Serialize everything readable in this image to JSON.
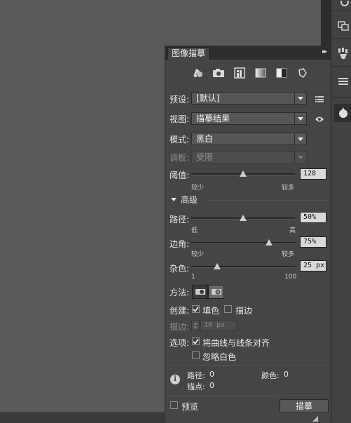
{
  "panel": {
    "title": "图像描摹",
    "menu_glyph": "▸▸"
  },
  "presets": [
    {
      "name": "auto-color-icon"
    },
    {
      "name": "high-color-icon"
    },
    {
      "name": "low-color-icon"
    },
    {
      "name": "grayscale-icon"
    },
    {
      "name": "black-white-icon"
    },
    {
      "name": "outline-icon"
    }
  ],
  "fields": {
    "preset_label": "预设:",
    "preset_value": "[默认]",
    "view_label": "视图:",
    "view_value": "描摹结果",
    "mode_label": "模式:",
    "mode_value": "黑白",
    "palette_label": "调板:",
    "palette_value": "受限",
    "threshold_label": "阈值:",
    "threshold_value": "128",
    "threshold_min": "较少",
    "threshold_max": "较多",
    "threshold_level": 0.5
  },
  "advanced": {
    "title": "高级",
    "paths_label": "路径:",
    "paths_value": "50%",
    "paths_min": "低",
    "paths_max": "高",
    "paths_level": 0.5,
    "corners_label": "边角:",
    "corners_value": "75%",
    "corners_min": "较少",
    "corners_max": "较多",
    "corners_level": 0.75,
    "noise_label": "杂色:",
    "noise_value": "25 px",
    "noise_min": "1",
    "noise_max": "100",
    "noise_level": 0.25,
    "method_label": "方法:",
    "create_label": "创建:",
    "fill_label": "填色",
    "fill_checked": true,
    "stroke_label": "描边",
    "stroke_checked": false,
    "stroke_width_label": "描边:",
    "stroke_width_value": "10 px",
    "options_label": "选项:",
    "snap_label": "将曲线与线条对齐",
    "snap_checked": true,
    "ignore_white_label": "忽略白色",
    "ignore_white_checked": false
  },
  "stats": {
    "paths_label": "路径:",
    "paths_value": "0",
    "colors_label": "颜色:",
    "colors_value": "0",
    "anchors_label": "锚点:",
    "anchors_value": "0"
  },
  "footer": {
    "preview_label": "预览",
    "trace_button": "描摹"
  },
  "colors": {
    "panel_bg": "#454545",
    "canvas_bg": "#595959",
    "field_bg": "#d9d9d9"
  }
}
